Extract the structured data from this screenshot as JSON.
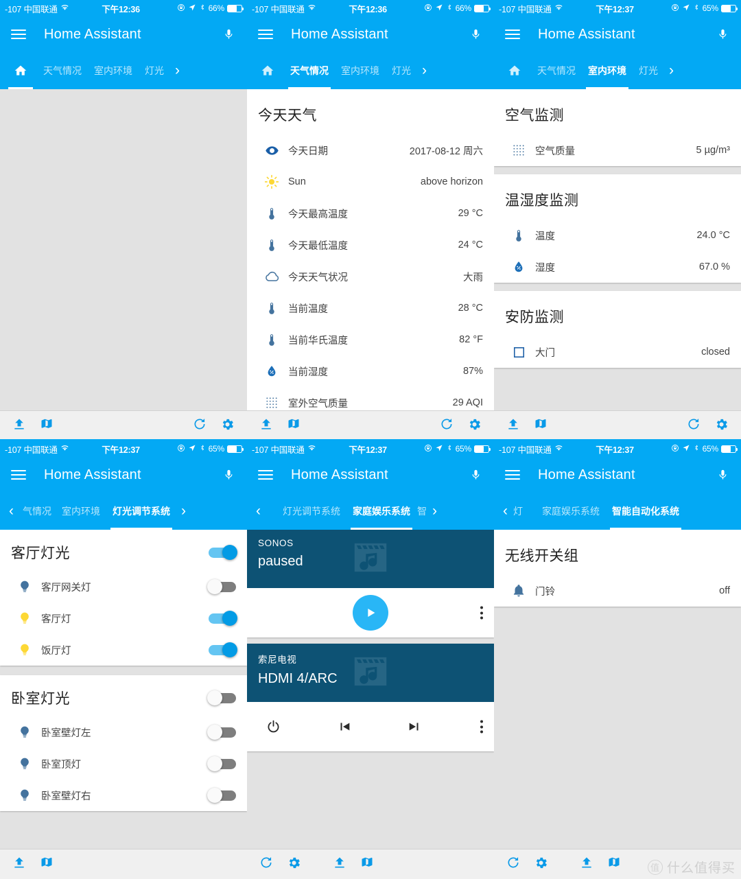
{
  "app": {
    "title": "Home Assistant",
    "menu_icon": "hamburger-icon",
    "mic_icon": "microphone-icon"
  },
  "status_bars": [
    {
      "carrier": "-107 中国联通",
      "time": "下午12:36",
      "battery": "66%"
    },
    {
      "carrier": "-107 中国联通",
      "time": "下午12:36",
      "battery": "66%"
    },
    {
      "carrier": "-107 中国联通",
      "time": "下午12:37",
      "battery": "65%"
    },
    {
      "carrier": "-107 中国联通",
      "time": "下午12:37",
      "battery": "65%"
    },
    {
      "carrier": "-107 中国联通",
      "time": "下午12:37",
      "battery": "65%"
    },
    {
      "carrier": "-107 中国联通",
      "time": "下午12:37",
      "battery": "65%"
    }
  ],
  "panels": [
    {
      "id": "panel-home",
      "tabs": [
        {
          "label": "home-icon",
          "type": "icon",
          "active": true
        },
        {
          "label": "天气情况",
          "active": false
        },
        {
          "label": "室内环境",
          "active": false
        },
        {
          "label": "灯光",
          "active": false
        }
      ],
      "next_arrow": "›",
      "prev_arrow": ""
    },
    {
      "id": "panel-weather",
      "tabs": [
        {
          "label": "home-icon",
          "type": "icon",
          "active": false
        },
        {
          "label": "天气情况",
          "active": true
        },
        {
          "label": "室内环境",
          "active": false
        },
        {
          "label": "灯光",
          "active": false
        }
      ],
      "next_arrow": "›",
      "prev_arrow": ""
    },
    {
      "id": "panel-indoor",
      "tabs": [
        {
          "label": "home-icon",
          "type": "icon",
          "active": false
        },
        {
          "label": "天气情况",
          "active": false
        },
        {
          "label": "室内环境",
          "active": true
        },
        {
          "label": "灯光",
          "active": false
        }
      ],
      "next_arrow": "›",
      "prev_arrow": ""
    },
    {
      "id": "panel-lights",
      "tabs": [
        {
          "label": "气情况",
          "active": false,
          "clipped": true
        },
        {
          "label": "室内环境",
          "active": false
        },
        {
          "label": "灯光调节系统",
          "active": true
        }
      ],
      "next_arrow": "›",
      "prev_arrow": "‹"
    },
    {
      "id": "panel-media",
      "tabs": [
        {
          "label": "灯光调节系统",
          "active": false
        },
        {
          "label": "家庭娱乐系统",
          "active": true
        },
        {
          "label": "智",
          "active": false,
          "clipped": true
        }
      ],
      "next_arrow": "›",
      "prev_arrow": "‹"
    },
    {
      "id": "panel-automation",
      "tabs": [
        {
          "label": "灯",
          "active": false,
          "clipped": true
        },
        {
          "label": "家庭娱乐系统",
          "active": false
        },
        {
          "label": "智能自动化系统",
          "active": true
        }
      ],
      "next_arrow": "",
      "prev_arrow": "‹"
    }
  ],
  "weather_card": {
    "title": "今天天气",
    "rows": [
      {
        "icon": "eye-icon",
        "label": "今天日期",
        "value": "2017-08-12 周六"
      },
      {
        "icon": "sun-icon",
        "label": "Sun",
        "value": "above horizon"
      },
      {
        "icon": "thermometer-icon",
        "label": "今天最高温度",
        "value": "29 °C"
      },
      {
        "icon": "thermometer-icon",
        "label": "今天最低温度",
        "value": "24 °C"
      },
      {
        "icon": "cloud-icon",
        "label": "今天天气状况",
        "value": "大雨"
      },
      {
        "icon": "thermometer-icon",
        "label": "当前温度",
        "value": "28 °C"
      },
      {
        "icon": "thermometer-icon",
        "label": "当前华氏温度",
        "value": "82 °F"
      },
      {
        "icon": "water-icon",
        "label": "当前湿度",
        "value": "87%"
      },
      {
        "icon": "dots-grid-icon",
        "label": "室外空气质量",
        "value": "29 AQI"
      }
    ]
  },
  "air_card": {
    "title": "空气监测",
    "rows": [
      {
        "icon": "dots-grid-icon",
        "label": "空气质量",
        "value": "5 µg/m³"
      }
    ]
  },
  "climate_card": {
    "title": "温湿度监测",
    "rows": [
      {
        "icon": "thermometer-icon",
        "label": "温度",
        "value": "24.0 °C"
      },
      {
        "icon": "water-icon",
        "label": "湿度",
        "value": "67.0 %"
      }
    ]
  },
  "security_card": {
    "title": "安防监测",
    "rows": [
      {
        "icon": "square-icon",
        "label": "大门",
        "value": "closed"
      }
    ]
  },
  "living_room_lights": {
    "title": "客厅灯光",
    "group_toggle": "on",
    "rows": [
      {
        "icon": "bulb-icon",
        "icon_color": "#44739e",
        "label": "客厅网关灯",
        "toggle": "off"
      },
      {
        "icon": "bulb-icon",
        "icon_color": "#fdd835",
        "label": "客厅灯",
        "toggle": "on"
      },
      {
        "icon": "bulb-icon",
        "icon_color": "#fdd835",
        "label": "饭厅灯",
        "toggle": "on"
      }
    ]
  },
  "bedroom_lights": {
    "title": "卧室灯光",
    "group_toggle": "off",
    "rows": [
      {
        "icon": "bulb-icon",
        "icon_color": "#44739e",
        "label": "卧室壁灯左",
        "toggle": "off"
      },
      {
        "icon": "bulb-icon",
        "icon_color": "#44739e",
        "label": "卧室顶灯",
        "toggle": "off"
      },
      {
        "icon": "bulb-icon",
        "icon_color": "#44739e",
        "label": "卧室壁灯右",
        "toggle": "off"
      }
    ]
  },
  "media_players": [
    {
      "name": "SONOS",
      "state": "paused",
      "controls": [
        "play-icon",
        "overflow-icon"
      ]
    },
    {
      "name": "索尼电视",
      "state": "HDMI 4/ARC",
      "controls": [
        "power-icon",
        "previous-icon",
        "next-icon",
        "overflow-icon"
      ]
    }
  ],
  "switch_group": {
    "title": "无线开关组",
    "rows": [
      {
        "icon": "bell-icon",
        "label": "门铃",
        "value": "off"
      }
    ]
  },
  "toolbar": {
    "left": [
      "upload-icon",
      "map-icon"
    ],
    "right": [
      "refresh-icon",
      "gear-icon"
    ]
  },
  "watermark": {
    "badge": "值",
    "text": "什么值得买"
  },
  "colors": {
    "primary": "#03a9f4",
    "accent": "#29b6f6",
    "media_card_bg": "#0d5274",
    "icon_blue": "#44739e",
    "bulb_on": "#fdd835",
    "toolbar_icon": "#0a9ae8",
    "page_bg": "#e2e2e2"
  }
}
